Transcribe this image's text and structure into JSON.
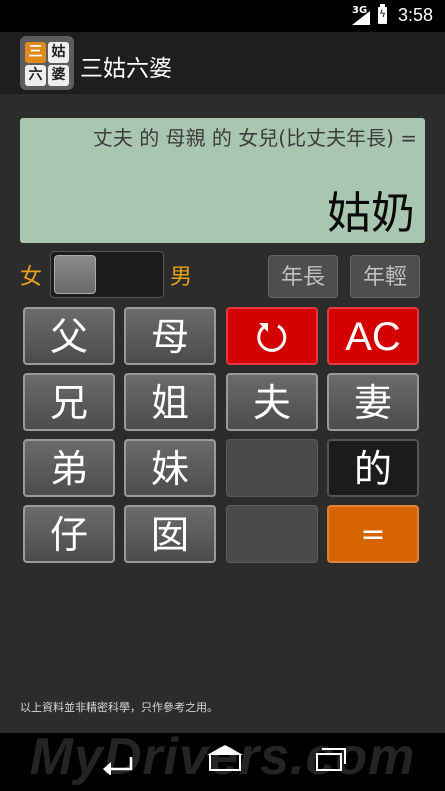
{
  "status_bar": {
    "network": "3G",
    "time": "3:58"
  },
  "app": {
    "title": "三姑六婆",
    "logo": [
      "三",
      "姑",
      "六",
      "婆"
    ]
  },
  "display": {
    "formula": "丈夫 的 母親 的 女兒(比丈夫年長) =",
    "result": "姑奶"
  },
  "gender": {
    "female": "女",
    "male": "男",
    "selected": "female"
  },
  "age_buttons": {
    "older": "年長",
    "younger": "年輕"
  },
  "keys": {
    "father": "父",
    "mother": "母",
    "undo": "↺",
    "clear": "AC",
    "elder_brother": "兄",
    "elder_sister": "姐",
    "husband": "夫",
    "wife": "妻",
    "younger_brother": "弟",
    "younger_sister": "妹",
    "possessive": "的",
    "son": "仔",
    "daughter": "囡",
    "equals": "="
  },
  "disclaimer": "以上資料並非精密科學，只作參考之用。",
  "watermark": "MyDrivers.com",
  "colors": {
    "accent": "#e8a21a",
    "undo_red": "#d40000",
    "equals_orange": "#d66400",
    "display_bg": "#a9c6b1"
  }
}
